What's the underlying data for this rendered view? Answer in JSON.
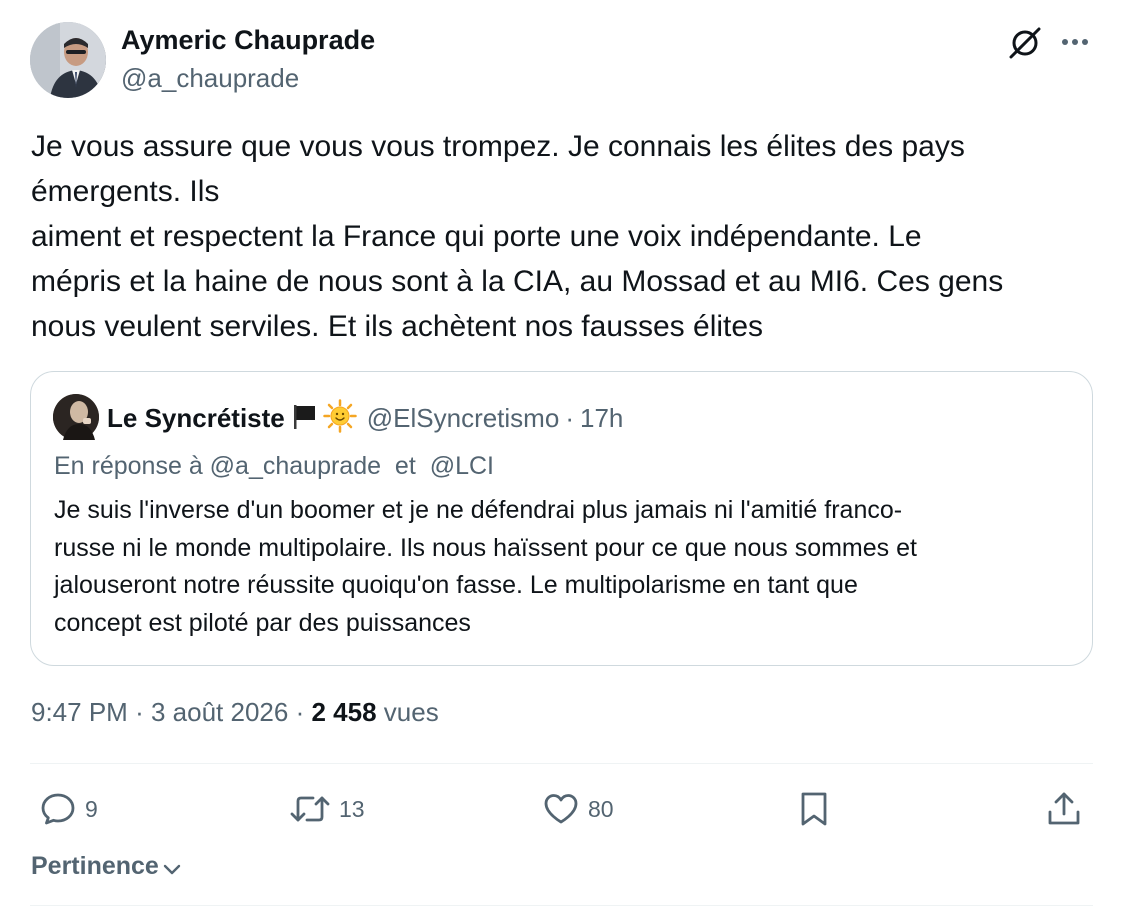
{
  "author": {
    "name": "Aymeric Chauprade",
    "handle": "@a_chauprade"
  },
  "tweet": {
    "lines": [
      "Je vous assure que vous vous trompez. Je connais les élites des pays",
      "émergents. Ils",
      "aiment et respectent la France qui porte une voix indépendante. Le",
      "mépris et la haine de nous sont à la CIA, au Mossad et au MI6. Ces gens",
      "nous veulent serviles. Et ils achètent nos fausses élites"
    ]
  },
  "quote": {
    "name": "Le Syncrétiste",
    "handle": "@ElSyncretismo",
    "separator": "·",
    "time": "17h",
    "reply_prefix": "En réponse à",
    "reply_mention_1": "@a_chauprade",
    "reply_and": "et",
    "reply_mention_2": "@LCI",
    "lines": [
      "Je suis l'inverse d'un boomer et je ne défendrai plus jamais ni l'amitié franco-",
      "russe ni le monde multipolaire. Ils nous haïssent pour ce que nous sommes et",
      "jalouseront notre réussite quoiqu'on fasse. Le multipolarisme en tant que",
      "concept est piloté par des puissances"
    ]
  },
  "meta": {
    "time": "9:47 PM",
    "sep1": "·",
    "date": "3 août 2026",
    "sep2": "·",
    "views_count": "2 458",
    "views_label": "vues"
  },
  "actions": {
    "replies": "9",
    "reposts": "13",
    "likes": "80"
  },
  "sort": {
    "label": "Pertinence"
  },
  "colors": {
    "text": "#0f1419",
    "secondary": "#536471",
    "border": "#cfd9de"
  },
  "icons": [
    "grok-icon",
    "more-icon",
    "reply-icon",
    "repost-icon",
    "like-icon",
    "bookmark-icon",
    "share-icon",
    "chevron-down-icon",
    "black-flag-icon",
    "sun-emoji-icon"
  ]
}
